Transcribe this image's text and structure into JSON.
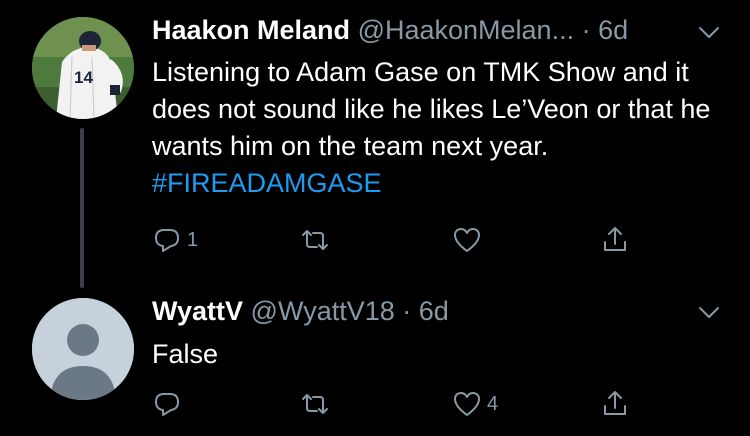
{
  "tweets": [
    {
      "display_name": "Haakon Meland",
      "handle": "@HaakonMelan...",
      "time": "· 6d",
      "body": "Listening to Adam Gase on TMK Show and it does not sound like he likes Le’Veon or that he wants him on the team next year.",
      "hashtag": "#FIREADAMGASE",
      "reply_count": "1",
      "retweet_count": "",
      "like_count": "",
      "avatar_jersey_number": "14"
    },
    {
      "display_name": "WyattV",
      "handle": "@WyattV18",
      "time": "· 6d",
      "body": "False",
      "reply_count": "",
      "retweet_count": "",
      "like_count": "4"
    }
  ],
  "colors": {
    "background": "#000000",
    "text": "#ffffff",
    "secondary": "#8899a6",
    "link": "#1d9bf0",
    "thread_line": "#3a4148"
  },
  "icons": [
    "reply-icon",
    "retweet-icon",
    "like-icon",
    "share-icon",
    "chevron-down-icon"
  ]
}
